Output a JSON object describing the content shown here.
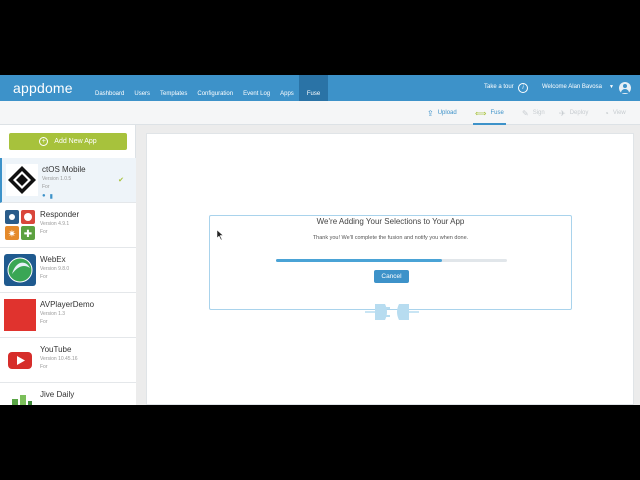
{
  "app": {
    "logo": "appdome"
  },
  "nav": {
    "items": [
      "Dashboard",
      "Users",
      "Templates",
      "Configuration",
      "Event Log",
      "Apps",
      "Fuse"
    ],
    "active": "Fuse",
    "take_tour": "Take a tour",
    "welcome": "Welcome Alan Bavosa"
  },
  "toolbar": {
    "items": [
      {
        "label": "Upload",
        "icon": "upload-icon",
        "state": "enabled"
      },
      {
        "label": "Fuse",
        "icon": "fuse-icon",
        "state": "active"
      },
      {
        "label": "Sign",
        "icon": "sign-icon",
        "state": "disabled"
      },
      {
        "label": "Deploy",
        "icon": "deploy-icon",
        "state": "disabled"
      },
      {
        "label": "View",
        "icon": "view-icon",
        "state": "disabled"
      }
    ]
  },
  "sidebar": {
    "add_button": "Add New App",
    "apps": [
      {
        "name": "ctOS Mobile",
        "version": "Version 1.0.5",
        "for": "For",
        "selected": true
      },
      {
        "name": "Responder",
        "version": "Version 4.9.1",
        "for": "For",
        "selected": false
      },
      {
        "name": "WebEx",
        "version": "Version 9.8.0",
        "for": "For",
        "selected": false
      },
      {
        "name": "AVPlayerDemo",
        "version": "Version 1.3",
        "for": "For",
        "selected": false
      },
      {
        "name": "YouTube",
        "version": "Version 10.45.16",
        "for": "For",
        "selected": false
      },
      {
        "name": "Jive Daily",
        "version": "",
        "for": "",
        "selected": false
      }
    ]
  },
  "dialog": {
    "title": "We're Adding Your Selections to Your App",
    "message": "Thank you! We'll complete the fusion and notify you when done.",
    "progress": 0.72,
    "cancel_label": "Cancel"
  },
  "colors": {
    "brand": "#3d92c9",
    "accent_green": "#a7c23c"
  }
}
